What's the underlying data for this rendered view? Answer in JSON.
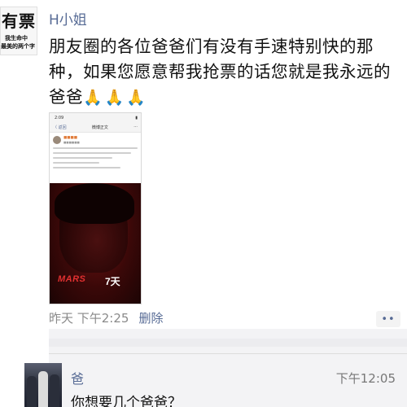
{
  "profile_avatar": {
    "title": "有票",
    "line1": "我生命中",
    "line2": "最美的两个字"
  },
  "post": {
    "author": "H小姐",
    "text": "朋友圈的各位爸爸们有没有手速特别快的那种，如果您愿意帮我抢票的话您就是我永远的爸爸",
    "emoji": "🙏🙏🙏",
    "time": "昨天 下午2:25",
    "delete_label": "删除",
    "more_label": "••"
  },
  "embedded_screenshot": {
    "clock": "2:09",
    "nav_back": "〈 返回",
    "nav_title": "微博正文",
    "poster_text": "MARS",
    "poster_days": "7天"
  },
  "comment": {
    "author": "爸",
    "time": "下午12:05",
    "text": "你想要几个爸爸？"
  },
  "colors": {
    "link_blue": "#576b95",
    "meta_gray": "#8a8a8a",
    "poster_red": "#7a1616"
  }
}
